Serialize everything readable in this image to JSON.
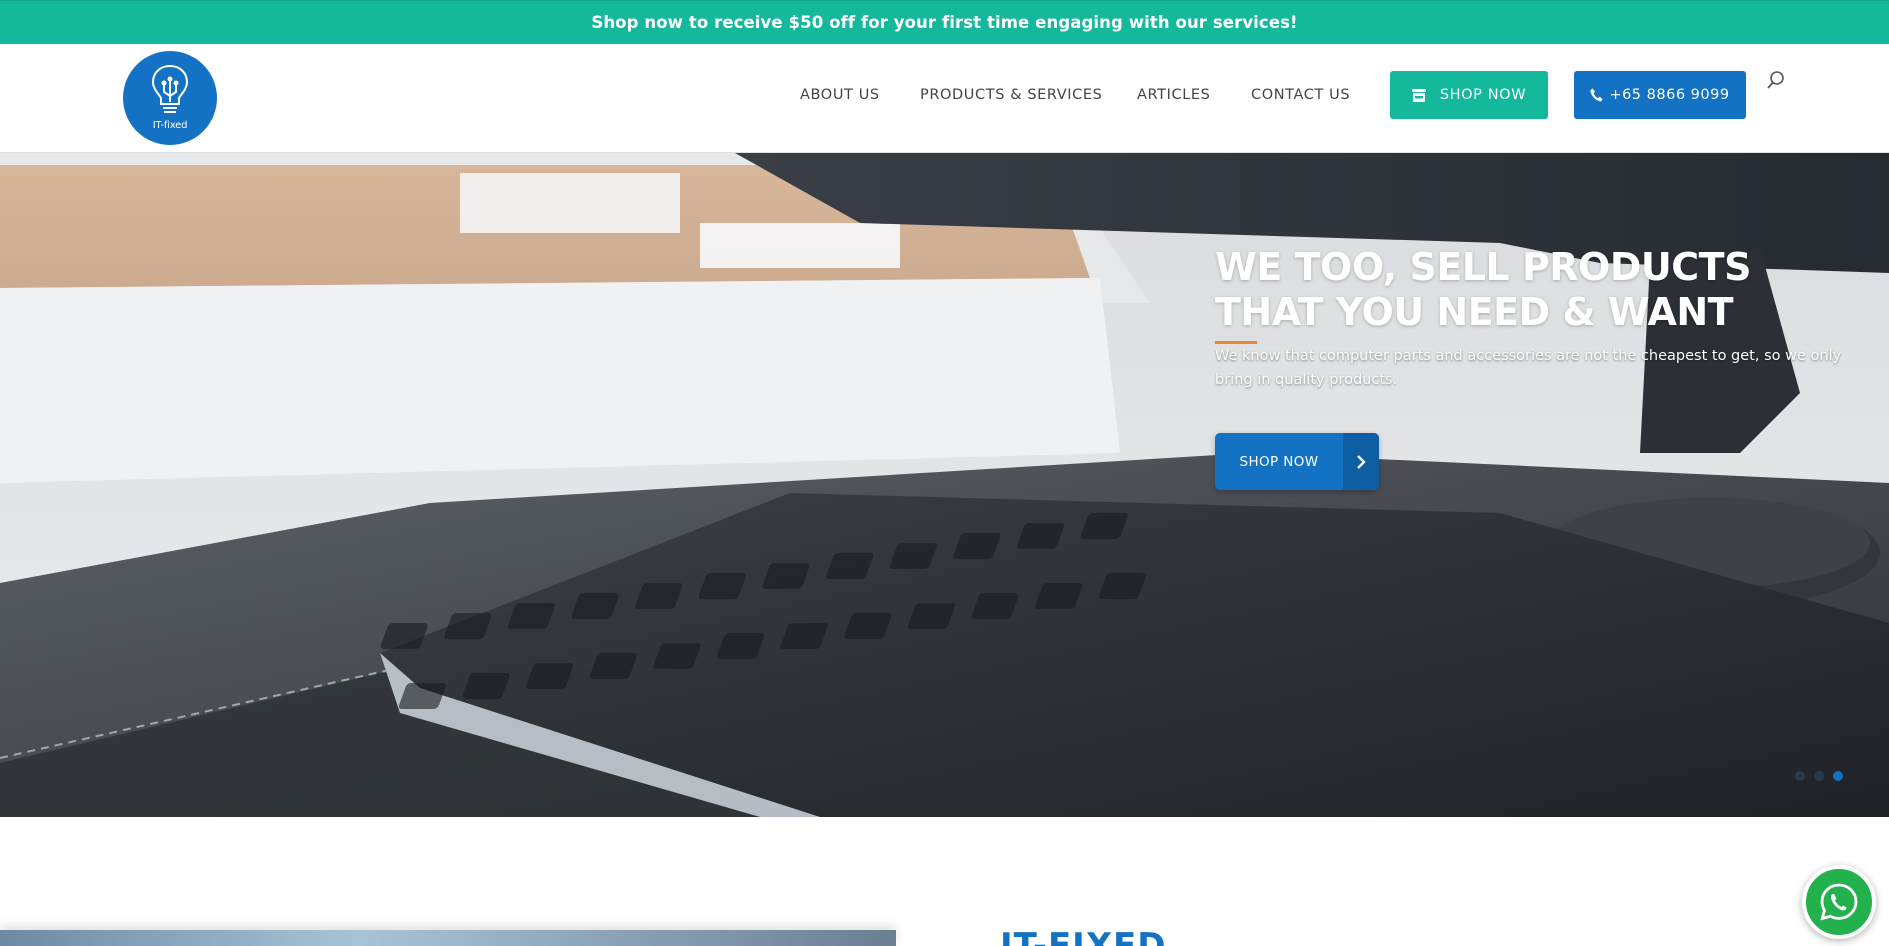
{
  "promo": {
    "text": "Shop now to receive $50 off for your first time engaging with our services!"
  },
  "header": {
    "logo_text": "IT-fixed",
    "logo_icon": "lightbulb-circuit-icon",
    "nav": [
      {
        "label": "ABOUT US"
      },
      {
        "label": "PRODUCTS & SERVICES"
      },
      {
        "label": "ARTICLES"
      },
      {
        "label": "CONTACT US"
      }
    ],
    "shop_button_label": "SHOP NOW",
    "shop_button_icon": "store-icon",
    "phone_button_label": "+65 8866 9099",
    "phone_button_icon": "phone-icon",
    "search_icon": "search-icon"
  },
  "hero": {
    "title": "WE TOO, SELL PRODUCTS THAT YOU NEED & WANT",
    "subtitle": "We know that computer parts and accessories are not the cheapest to get, so we only bring in quality products.",
    "button_label": "SHOP NOW",
    "button_icon": "chevron-right-icon",
    "slides_total": 3,
    "active_slide": 3
  },
  "lower": {
    "heading": "IT-FIXED"
  },
  "floating": {
    "whatsapp_icon": "whatsapp-icon"
  },
  "colors": {
    "teal": "#14b99c",
    "blue": "#1372c3",
    "accent_orange": "#e98a2c"
  }
}
